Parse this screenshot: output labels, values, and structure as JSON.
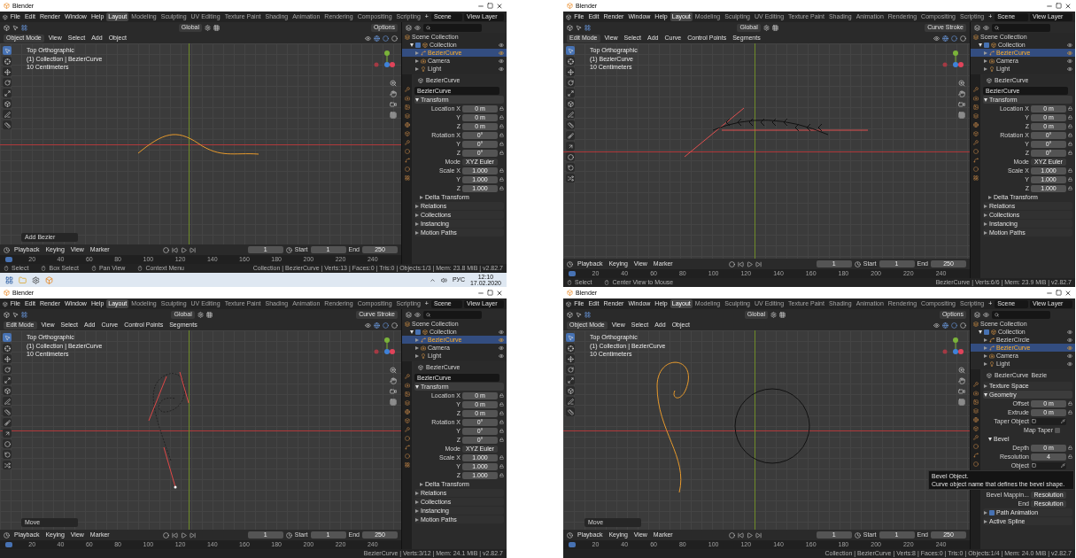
{
  "windows": [
    {
      "title": "Blender",
      "menu": [
        "File",
        "Edit",
        "Render",
        "Window",
        "Help"
      ],
      "workspaces": [
        {
          "label": "Layout",
          "selected": true
        },
        {
          "label": "Modeling",
          "selected": false
        },
        {
          "label": "Sculpting",
          "selected": false
        },
        {
          "label": "UV Editing",
          "selected": false
        },
        {
          "label": "Texture Paint",
          "selected": false
        },
        {
          "label": "Shading",
          "selected": false
        },
        {
          "label": "Animation",
          "selected": false
        },
        {
          "label": "Rendering",
          "selected": false
        },
        {
          "label": "Compositing",
          "selected": false
        },
        {
          "label": "Scripting",
          "selected": false
        }
      ],
      "add_tab": "+",
      "scene": "Scene",
      "view_layer": "View Layer",
      "viewport": {
        "orientation": "Global",
        "options": "Options",
        "mode": "Object Mode",
        "kind": "object",
        "menus": [
          "View",
          "Select",
          "Add",
          "Object"
        ],
        "overlay": [
          "Top Orthographic",
          "(1) Collection | BezierCurve",
          "10 Centimeters"
        ],
        "operator": "Add Bezier"
      },
      "outliner": {
        "items": [
          {
            "label": "Scene Collection",
            "kind": "scene",
            "selected": false,
            "children": [
              {
                "label": "Collection",
                "kind": "collection",
                "selected": false,
                "expanded": true,
                "checked": true,
                "children": [
                  {
                    "label": "BezierCurve",
                    "kind": "curve",
                    "selected": true,
                    "expanded": false
                  },
                  {
                    "label": "Camera",
                    "kind": "camera",
                    "selected": false,
                    "expanded": false
                  },
                  {
                    "label": "Light",
                    "kind": "light",
                    "selected": false,
                    "expanded": false
                  }
                ]
              }
            ]
          }
        ]
      },
      "properties": {
        "header": "BezierCurve",
        "rows": [
          {
            "kind": "name-field",
            "value": "BezierCurve"
          },
          {
            "kind": "section",
            "label": "Transform",
            "expanded": true
          },
          {
            "kind": "field",
            "label": "Location X",
            "value": "0 m"
          },
          {
            "kind": "field",
            "label": "Y",
            "value": "0 m"
          },
          {
            "kind": "field",
            "label": "Z",
            "value": "0 m"
          },
          {
            "kind": "field",
            "label": "Rotation X",
            "value": "0°"
          },
          {
            "kind": "field",
            "label": "Y",
            "value": "0°"
          },
          {
            "kind": "field",
            "label": "Z",
            "value": "0°"
          },
          {
            "kind": "enum",
            "label": "Mode",
            "value": "XYZ Euler"
          },
          {
            "kind": "field",
            "label": "Scale X",
            "value": "1.000"
          },
          {
            "kind": "field",
            "label": "Y",
            "value": "1.000"
          },
          {
            "kind": "field",
            "label": "Z",
            "value": "1.000"
          },
          {
            "kind": "subsection",
            "label": "Delta Transform",
            "expanded": false
          },
          {
            "kind": "section",
            "label": "Relations",
            "expanded": false
          },
          {
            "kind": "section",
            "label": "Collections",
            "expanded": false
          },
          {
            "kind": "section",
            "label": "Instancing",
            "expanded": false
          },
          {
            "kind": "section",
            "label": "Motion Paths",
            "expanded": false
          }
        ]
      },
      "timeline": {
        "menus": [
          "Playback",
          "Keying",
          "View",
          "Marker"
        ],
        "frame": "1",
        "start_label": "Start",
        "start": "1",
        "end_label": "End",
        "end": "250",
        "ticks": [
          "20",
          "40",
          "60",
          "80",
          "100",
          "120",
          "140",
          "160",
          "180",
          "200",
          "220",
          "240"
        ]
      },
      "status": {
        "items": [
          "Select",
          "Box Select",
          "Pan View",
          "Context Menu"
        ],
        "stats": "Collection | BezierCurve | Verts:13 | Faces:0 | Tris:0 | Objects:1/3 | Mem: 23.8 MiB | v2.82.7"
      },
      "taskbar": {
        "language": "РУС",
        "time": "12:10",
        "date": "17.02.2020"
      }
    },
    {
      "title": "Blender",
      "menu": [
        "File",
        "Edit",
        "Render",
        "Window",
        "Help"
      ],
      "workspaces": [
        {
          "label": "Layout",
          "selected": true
        },
        {
          "label": "Modeling",
          "selected": false
        },
        {
          "label": "Sculpting",
          "selected": false
        },
        {
          "label": "UV Editing",
          "selected": false
        },
        {
          "label": "Texture Paint",
          "selected": false
        },
        {
          "label": "Shading",
          "selected": false
        },
        {
          "label": "Animation",
          "selected": false
        },
        {
          "label": "Rendering",
          "selected": false
        },
        {
          "label": "Compositing",
          "selected": false
        },
        {
          "label": "Scripting",
          "selected": false
        }
      ],
      "add_tab": "+",
      "scene": "Scene",
      "view_layer": "View Layer",
      "viewport": {
        "orientation": "Global",
        "options": "Curve Stroke",
        "mode": "Edit Mode",
        "kind": "edit",
        "menus": [
          "View",
          "Select",
          "Add",
          "Curve",
          "Control Points",
          "Segments"
        ],
        "overlay": [
          "Top Orthographic",
          "(1) BezierCurve",
          "10 Centimeters"
        ]
      },
      "outliner": {
        "items": [
          {
            "label": "Scene Collection",
            "kind": "scene",
            "selected": false,
            "children": [
              {
                "label": "Collection",
                "kind": "collection",
                "selected": false,
                "expanded": true,
                "checked": true,
                "children": [
                  {
                    "label": "BezierCurve",
                    "kind": "curve",
                    "selected": true,
                    "expanded": false
                  },
                  {
                    "label": "Camera",
                    "kind": "camera",
                    "selected": false,
                    "expanded": false
                  },
                  {
                    "label": "Light",
                    "kind": "light",
                    "selected": false,
                    "expanded": false
                  }
                ]
              }
            ]
          }
        ]
      },
      "properties": {
        "header": "BezierCurve",
        "rows": [
          {
            "kind": "name-field",
            "value": "BezierCurve"
          },
          {
            "kind": "section",
            "label": "Transform",
            "expanded": true
          },
          {
            "kind": "field",
            "label": "Location X",
            "value": "0 m"
          },
          {
            "kind": "field",
            "label": "Y",
            "value": "0 m"
          },
          {
            "kind": "field",
            "label": "Z",
            "value": "0 m"
          },
          {
            "kind": "field",
            "label": "Rotation X",
            "value": "0°"
          },
          {
            "kind": "field",
            "label": "Y",
            "value": "0°"
          },
          {
            "kind": "field",
            "label": "Z",
            "value": "0°"
          },
          {
            "kind": "enum",
            "label": "Mode",
            "value": "XYZ Euler"
          },
          {
            "kind": "field",
            "label": "Scale X",
            "value": "1.000"
          },
          {
            "kind": "field",
            "label": "Y",
            "value": "1.000"
          },
          {
            "kind": "field",
            "label": "Z",
            "value": "1.000"
          },
          {
            "kind": "subsection",
            "label": "Delta Transform",
            "expanded": false
          },
          {
            "kind": "section",
            "label": "Relations",
            "expanded": false
          },
          {
            "kind": "section",
            "label": "Collections",
            "expanded": false
          },
          {
            "kind": "section",
            "label": "Instancing",
            "expanded": false
          },
          {
            "kind": "section",
            "label": "Motion Paths",
            "expanded": false
          }
        ]
      },
      "timeline": {
        "menus": [
          "Playback",
          "Keying",
          "View",
          "Marker"
        ],
        "frame": "1",
        "start_label": "Start",
        "start": "1",
        "end_label": "End",
        "end": "250",
        "ticks": [
          "20",
          "40",
          "60",
          "80",
          "100",
          "120",
          "140",
          "160",
          "180",
          "200",
          "220",
          "240"
        ]
      },
      "status": {
        "items": [
          "Select",
          "Center View to Mouse"
        ],
        "stats": "BezierCurve | Verts:6/6 | Mem: 23.9 MiB | v2.82.7"
      }
    },
    {
      "title": "Blender",
      "menu": [
        "File",
        "Edit",
        "Render",
        "Window",
        "Help"
      ],
      "workspaces": [
        {
          "label": "Layout",
          "selected": true
        },
        {
          "label": "Modeling",
          "selected": false
        },
        {
          "label": "Sculpting",
          "selected": false
        },
        {
          "label": "UV Editing",
          "selected": false
        },
        {
          "label": "Texture Paint",
          "selected": false
        },
        {
          "label": "Shading",
          "selected": false
        },
        {
          "label": "Animation",
          "selected": false
        },
        {
          "label": "Rendering",
          "selected": false
        },
        {
          "label": "Compositing",
          "selected": false
        },
        {
          "label": "Scripting",
          "selected": false
        }
      ],
      "add_tab": "+",
      "scene": "Scene",
      "view_layer": "View Layer",
      "viewport": {
        "orientation": "Global",
        "options": "Curve Stroke",
        "mode": "Edit Mode",
        "kind": "edit",
        "menus": [
          "View",
          "Select",
          "Add",
          "Curve",
          "Control Points",
          "Segments"
        ],
        "overlay": [
          "Top Orthographic",
          "(1) Collection | BezierCurve",
          "10 Centimeters"
        ],
        "operator": "Move"
      },
      "outliner": {
        "items": [
          {
            "label": "Scene Collection",
            "kind": "scene",
            "selected": false,
            "children": [
              {
                "label": "Collection",
                "kind": "collection",
                "selected": false,
                "expanded": true,
                "checked": true,
                "children": [
                  {
                    "label": "BezierCurve",
                    "kind": "curve",
                    "selected": true,
                    "expanded": false
                  },
                  {
                    "label": "Camera",
                    "kind": "camera",
                    "selected": false,
                    "expanded": false
                  },
                  {
                    "label": "Light",
                    "kind": "light",
                    "selected": false,
                    "expanded": false
                  }
                ]
              }
            ]
          }
        ]
      },
      "properties": {
        "header": "BezierCurve",
        "rows": [
          {
            "kind": "name-field",
            "value": "BezierCurve"
          },
          {
            "kind": "section",
            "label": "Transform",
            "expanded": true
          },
          {
            "kind": "field",
            "label": "Location X",
            "value": "0 m"
          },
          {
            "kind": "field",
            "label": "Y",
            "value": "0 m"
          },
          {
            "kind": "field",
            "label": "Z",
            "value": "0 m"
          },
          {
            "kind": "field",
            "label": "Rotation X",
            "value": "0°"
          },
          {
            "kind": "field",
            "label": "Y",
            "value": "0°"
          },
          {
            "kind": "field",
            "label": "Z",
            "value": "0°"
          },
          {
            "kind": "enum",
            "label": "Mode",
            "value": "XYZ Euler"
          },
          {
            "kind": "field",
            "label": "Scale X",
            "value": "1.000"
          },
          {
            "kind": "field",
            "label": "Y",
            "value": "1.000"
          },
          {
            "kind": "field",
            "label": "Z",
            "value": "1.000"
          },
          {
            "kind": "subsection",
            "label": "Delta Transform",
            "expanded": false
          },
          {
            "kind": "section",
            "label": "Relations",
            "expanded": false
          },
          {
            "kind": "section",
            "label": "Collections",
            "expanded": false
          },
          {
            "kind": "section",
            "label": "Instancing",
            "expanded": false
          },
          {
            "kind": "section",
            "label": "Motion Paths",
            "expanded": false
          }
        ]
      },
      "timeline": {
        "menus": [
          "Playback",
          "Keying",
          "View",
          "Marker"
        ],
        "frame": "1",
        "start_label": "Start",
        "start": "1",
        "end_label": "End",
        "end": "250",
        "ticks": [
          "20",
          "40",
          "60",
          "80",
          "100",
          "120",
          "140",
          "160",
          "180",
          "200",
          "220",
          "240"
        ]
      },
      "status": {
        "stats": "BezierCurve | Verts:3/12 | Mem: 24.1 MiB | v2.82.7"
      }
    },
    {
      "title": "Blender",
      "menu": [
        "File",
        "Edit",
        "Render",
        "Window",
        "Help"
      ],
      "workspaces": [
        {
          "label": "Layout",
          "selected": true
        },
        {
          "label": "Modeling",
          "selected": false
        },
        {
          "label": "Sculpting",
          "selected": false
        },
        {
          "label": "UV Editing",
          "selected": false
        },
        {
          "label": "Texture Paint",
          "selected": false
        },
        {
          "label": "Shading",
          "selected": false
        },
        {
          "label": "Animation",
          "selected": false
        },
        {
          "label": "Rendering",
          "selected": false
        },
        {
          "label": "Compositing",
          "selected": false
        },
        {
          "label": "Scripting",
          "selected": false
        }
      ],
      "add_tab": "+",
      "scene": "Scene",
      "view_layer": "View Layer",
      "viewport": {
        "orientation": "Global",
        "options": "Options",
        "mode": "Object Mode",
        "kind": "object",
        "menus": [
          "View",
          "Select",
          "Add",
          "Object"
        ],
        "overlay": [
          "Top Orthographic",
          "(1) Collection | BezierCurve",
          "10 Centimeters"
        ],
        "operator": "Move"
      },
      "outliner": {
        "items": [
          {
            "label": "Scene Collection",
            "kind": "scene",
            "selected": false,
            "children": [
              {
                "label": "Collection",
                "kind": "collection",
                "selected": false,
                "expanded": true,
                "checked": true,
                "children": [
                  {
                    "label": "BezierCircle",
                    "kind": "curve",
                    "selected": false,
                    "expanded": false
                  },
                  {
                    "label": "BezierCurve",
                    "kind": "curve",
                    "selected": true,
                    "expanded": false
                  },
                  {
                    "label": "Camera",
                    "kind": "camera",
                    "selected": false,
                    "expanded": false
                  },
                  {
                    "label": "Light",
                    "kind": "light",
                    "selected": false,
                    "expanded": false
                  }
                ]
              }
            ]
          }
        ]
      },
      "properties": {
        "header": "BezierCurve",
        "header_extra": "Bezie",
        "rows": [
          {
            "kind": "section",
            "label": "Texture Space",
            "expanded": false
          },
          {
            "kind": "section",
            "label": "Geometry",
            "expanded": true
          },
          {
            "kind": "field",
            "label": "Offset",
            "value": "0 m"
          },
          {
            "kind": "field",
            "label": "Extrude",
            "value": "0 m"
          },
          {
            "kind": "object-field",
            "label": "Taper Object"
          },
          {
            "kind": "checkbox",
            "label": "Map Taper",
            "checked": false
          },
          {
            "kind": "subsection",
            "label": "Bevel",
            "expanded": true
          },
          {
            "kind": "field",
            "label": "Depth",
            "value": "0 m"
          },
          {
            "kind": "field",
            "label": "Resolution",
            "value": "4"
          },
          {
            "kind": "object-field",
            "label": "Object"
          },
          {
            "kind": "tooltip",
            "title": "Bevel Object.",
            "text": "Curve object name that defines the bevel shape."
          },
          {
            "kind": "enum",
            "label": "Bevel Mappin...",
            "value": "Resolution"
          },
          {
            "kind": "enum",
            "label": "End",
            "value": "Resolution"
          },
          {
            "kind": "section",
            "label": "Path Animation",
            "expanded": false,
            "checked": true
          },
          {
            "kind": "section",
            "label": "Active Spline",
            "expanded": false
          }
        ]
      },
      "timeline": {
        "menus": [
          "Playback",
          "Keying",
          "View",
          "Marker"
        ],
        "frame": "1",
        "start_label": "Start",
        "start": "1",
        "end_label": "End",
        "end": "250",
        "ticks": [
          "20",
          "40",
          "60",
          "80",
          "100",
          "120",
          "140",
          "160",
          "180",
          "200",
          "220",
          "240"
        ]
      },
      "status": {
        "stats": "Collection | BezierCurve | Verts:8 | Faces:0 | Tris:0 | Objects:1/4 | Mem: 24.0 MiB | v2.82.7"
      }
    }
  ]
}
